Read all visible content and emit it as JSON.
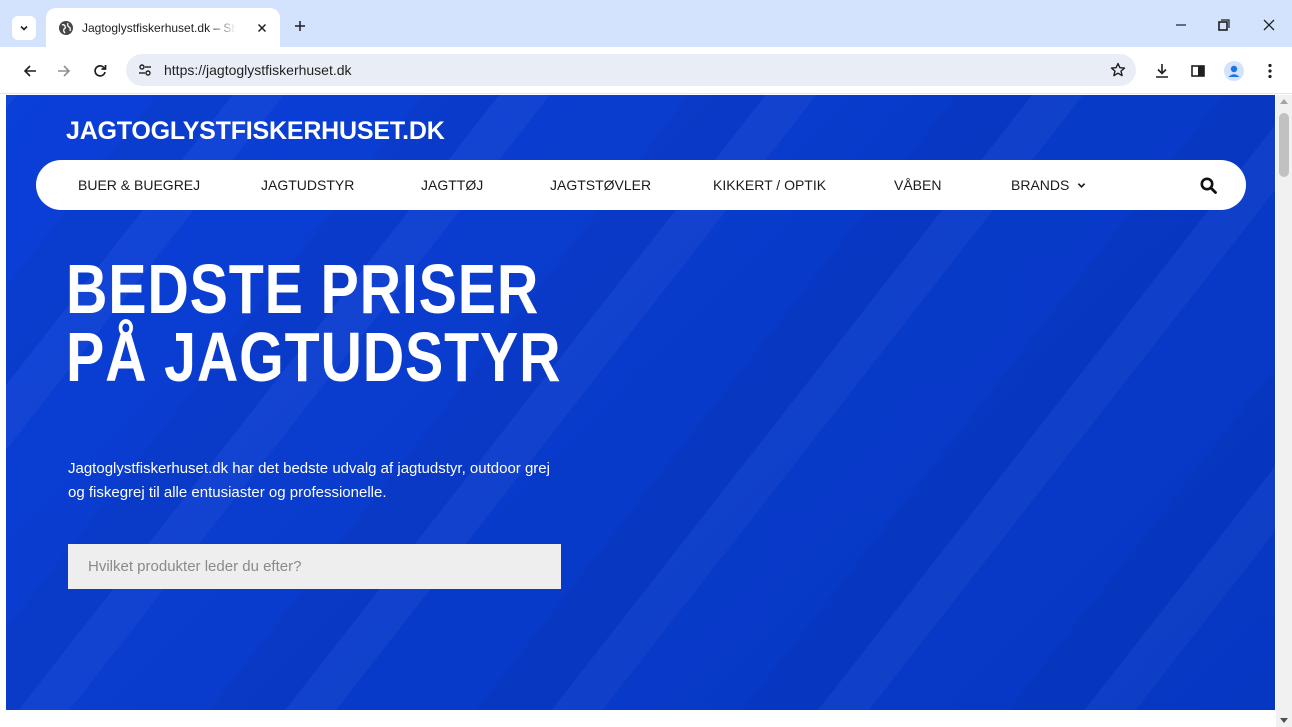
{
  "browser": {
    "tab": {
      "title": "Jagtoglystfiskerhuset.dk – Sted"
    },
    "url": "https://jagtoglystfiskerhuset.dk",
    "icons": {
      "tab_search": "chevron-down-icon",
      "favicon": "globe-icon",
      "tab_close": "close-icon",
      "new_tab": "plus-icon",
      "back": "arrow-left-icon",
      "forward": "arrow-right-icon",
      "reload": "reload-icon",
      "site_info": "tune-icon",
      "bookmark": "star-icon",
      "download": "download-icon",
      "side_panel": "side-panel-icon",
      "profile": "profile-icon",
      "menu": "kebab-icon"
    },
    "colors": {
      "tabbar": "#d3e3fd",
      "omnibox": "#e9eef6",
      "profile": "#1a73e8"
    }
  },
  "site": {
    "logo": "JAGTOGLYSTFISKERHUSET.DK",
    "nav": {
      "items": [
        {
          "label": "BUER & BUEGREJ"
        },
        {
          "label": "JAGTUDSTYR"
        },
        {
          "label": "JAGTTØJ"
        },
        {
          "label": "JAGTSTØVLER"
        },
        {
          "label": "KIKKERT / OPTIK"
        },
        {
          "label": "VÅBEN"
        },
        {
          "label": "BRANDS",
          "has_dropdown": true
        }
      ],
      "search_icon": "search-icon"
    },
    "hero": {
      "headline_line1": "BEDSTE PRISER",
      "headline_line2": "PÅ JAGTUDSTYR",
      "lede": "Jagtoglystfiskerhuset.dk har det bedste udvalg af jagtudstyr, outdoor grej og fiskegrej til alle entusiaster og professionelle.",
      "search_placeholder": "Hvilket produkter leder du efter?"
    },
    "colors": {
      "hero_blue": "#0a3ccf",
      "text_on_blue": "#ffffff",
      "search_bg": "#eeeeee"
    }
  }
}
